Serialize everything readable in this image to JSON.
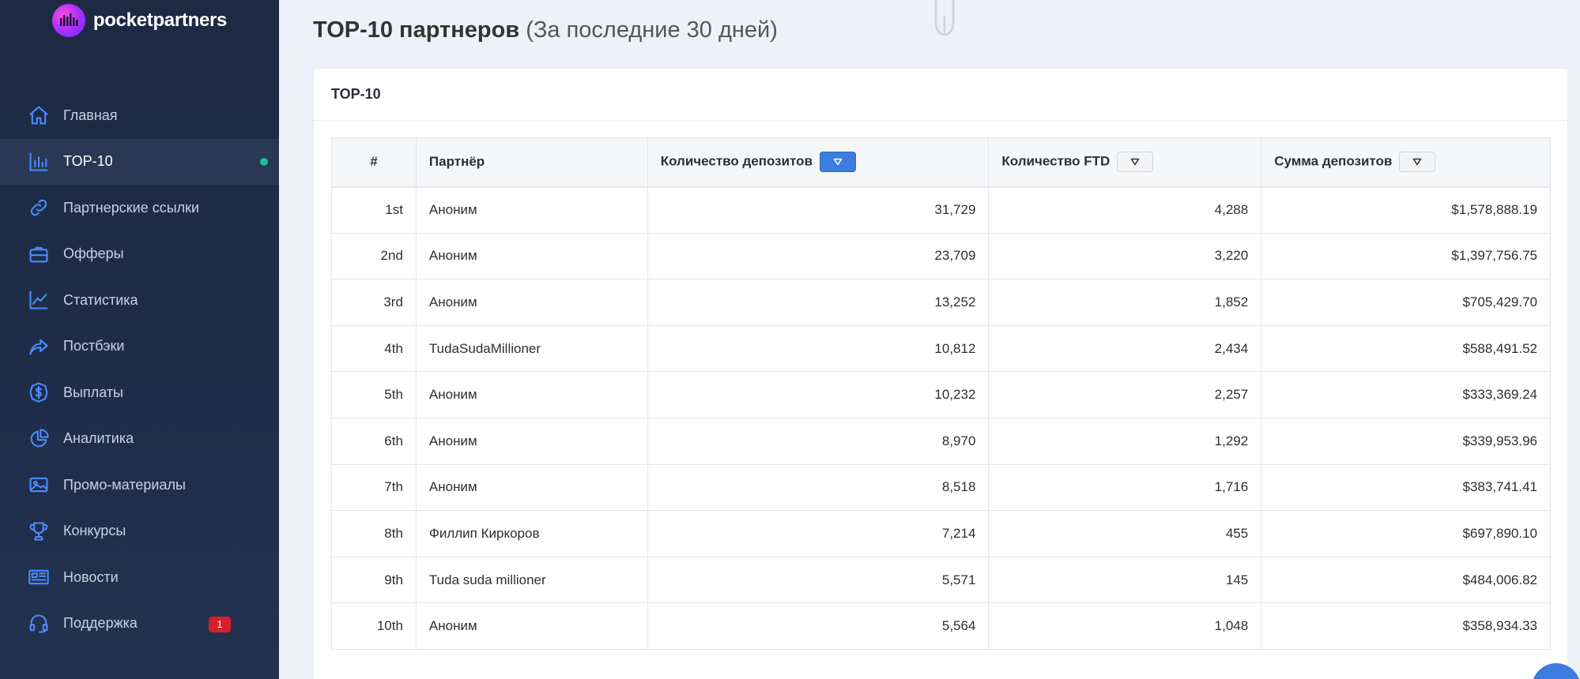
{
  "brand": {
    "name": "pocketpartners"
  },
  "sidebar": {
    "items": [
      {
        "label": "Главная",
        "icon": "home-icon"
      },
      {
        "label": "TOP-10",
        "icon": "bar-chart-icon",
        "active": true
      },
      {
        "label": "Партнерские ссылки",
        "icon": "link-icon"
      },
      {
        "label": "Офферы",
        "icon": "briefcase-icon"
      },
      {
        "label": "Статистика",
        "icon": "trend-icon"
      },
      {
        "label": "Постбэки",
        "icon": "share-icon"
      },
      {
        "label": "Выплаты",
        "icon": "coin-icon"
      },
      {
        "label": "Аналитика",
        "icon": "pie-chart-icon"
      },
      {
        "label": "Промо-материалы",
        "icon": "image-icon"
      },
      {
        "label": "Конкурсы",
        "icon": "trophy-icon"
      },
      {
        "label": "Новости",
        "icon": "newspaper-icon"
      },
      {
        "label": "Поддержка",
        "icon": "headset-icon",
        "badge": "1"
      }
    ]
  },
  "page": {
    "title": "TOP-10 партнеров",
    "subtitle": "(За последние 30 дней)"
  },
  "card": {
    "title": "TOP-10"
  },
  "table": {
    "headers": {
      "rank": "#",
      "partner": "Партнёр",
      "deposits_count": "Количество депозитов",
      "ftd_count": "Количество FTD",
      "deposits_sum": "Сумма депозитов"
    },
    "rows": [
      {
        "rank": "1st",
        "partner": "Аноним",
        "deposits": "31,729",
        "ftd": "4,288",
        "sum": "$1,578,888.19"
      },
      {
        "rank": "2nd",
        "partner": "Аноним",
        "deposits": "23,709",
        "ftd": "3,220",
        "sum": "$1,397,756.75"
      },
      {
        "rank": "3rd",
        "partner": "Аноним",
        "deposits": "13,252",
        "ftd": "1,852",
        "sum": "$705,429.70"
      },
      {
        "rank": "4th",
        "partner": "TudaSudaMillioner",
        "deposits": "10,812",
        "ftd": "2,434",
        "sum": "$588,491.52"
      },
      {
        "rank": "5th",
        "partner": "Аноним",
        "deposits": "10,232",
        "ftd": "2,257",
        "sum": "$333,369.24"
      },
      {
        "rank": "6th",
        "partner": "Аноним",
        "deposits": "8,970",
        "ftd": "1,292",
        "sum": "$339,953.96"
      },
      {
        "rank": "7th",
        "partner": "Аноним",
        "deposits": "8,518",
        "ftd": "1,716",
        "sum": "$383,741.41"
      },
      {
        "rank": "8th",
        "partner": "Филлип Киркоров",
        "deposits": "7,214",
        "ftd": "455",
        "sum": "$697,890.10"
      },
      {
        "rank": "9th",
        "partner": "Tuda suda millioner",
        "deposits": "5,571",
        "ftd": "145",
        "sum": "$484,006.82"
      },
      {
        "rank": "10th",
        "partner": "Аноним",
        "deposits": "5,564",
        "ftd": "1,048",
        "sum": "$358,934.33"
      }
    ]
  },
  "colors": {
    "sidebar_bg": "#1f2d4a",
    "accent": "#3b7de0",
    "online_dot": "#19c39c",
    "badge": "#d61f2a"
  }
}
